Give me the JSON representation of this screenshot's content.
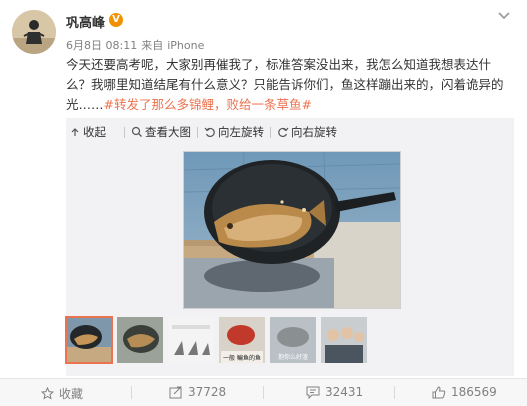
{
  "post": {
    "author": "巩高峰",
    "verified_mark": "V",
    "date": "6月8日 08:11",
    "source_prefix": "来自",
    "source": "iPhone",
    "text": "今天还要高考呢，大家别再催我了，标准答案没出来，我怎么知道我想表达什么？我哪里知道结尾有什么意义？只能告诉你们，鱼这样蹦出来的，闪着诡异的光……",
    "hashtag": "#转发了那么多锦鲤，败给一条草鱼#"
  },
  "media_toolbar": {
    "collapse": "收起",
    "view_large": "查看大图",
    "rotate_left": "向左旋转",
    "rotate_right": "向右旋转"
  },
  "thumbnail_captions": [
    "一般 鳊鱼的鱼",
    "抱你么好渣"
  ],
  "actions": {
    "favorite": "收藏",
    "repost_count": "37728",
    "comment_count": "32431",
    "like_count": "186569"
  },
  "colors": {
    "accent": "#eb7350",
    "verified": "#f29100",
    "meta_gray": "#808080",
    "panel_bg": "#f2f2f5"
  },
  "icons": {
    "verified": "verified-badge-icon",
    "menu": "chevron-down-icon",
    "collapse": "collapse-arrow-icon",
    "view_large": "magnifier-icon",
    "rotate_left": "rotate-left-icon",
    "rotate_right": "rotate-right-icon",
    "favorite": "star-icon",
    "repost": "repost-icon",
    "comment": "comment-icon",
    "like": "thumbs-up-icon"
  }
}
